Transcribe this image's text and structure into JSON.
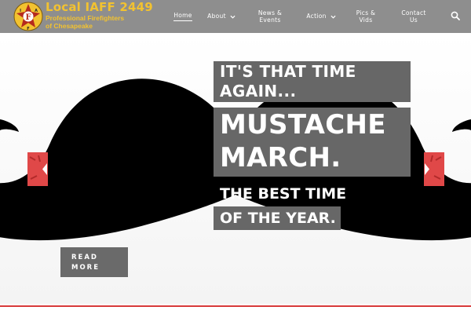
{
  "brand": {
    "title": "Local IAFF 2449",
    "subtitle_line1": "Professional Firefighters",
    "subtitle_line2": "of Chesapeake",
    "badge_letters": [
      "I",
      "A",
      "F",
      "F"
    ],
    "badge_icon": "iaff-maltese-cross-logo",
    "title_color": "#f2c230"
  },
  "nav": {
    "items": [
      {
        "label": "Home",
        "active": true
      },
      {
        "label": "About",
        "has_dropdown": true
      },
      {
        "label_line1": "News &",
        "label_line2": "Events"
      },
      {
        "label": "Action",
        "has_dropdown": true
      },
      {
        "label_line1": "Pics &",
        "label_line2": "Vids"
      },
      {
        "label_line1": "Contact",
        "label_line2": "Us"
      }
    ],
    "search_icon": "search-icon"
  },
  "hero": {
    "headline_line1": "IT'S THAT TIME",
    "headline_line2": "AGAIN...",
    "title_line1": "MUSTACHE",
    "title_line2": "MARCH.",
    "tagline_line1": "THE BEST TIME",
    "tagline_line2": "OF THE YEAR.",
    "read_more_line1": "READ",
    "read_more_line2": "MORE",
    "background_icon": "mustache-illustration",
    "prev_icon": "chevron-left-icon",
    "next_icon": "chevron-right-icon",
    "accent_color": "#d93a3a",
    "header_color": "#8e8e8e"
  }
}
